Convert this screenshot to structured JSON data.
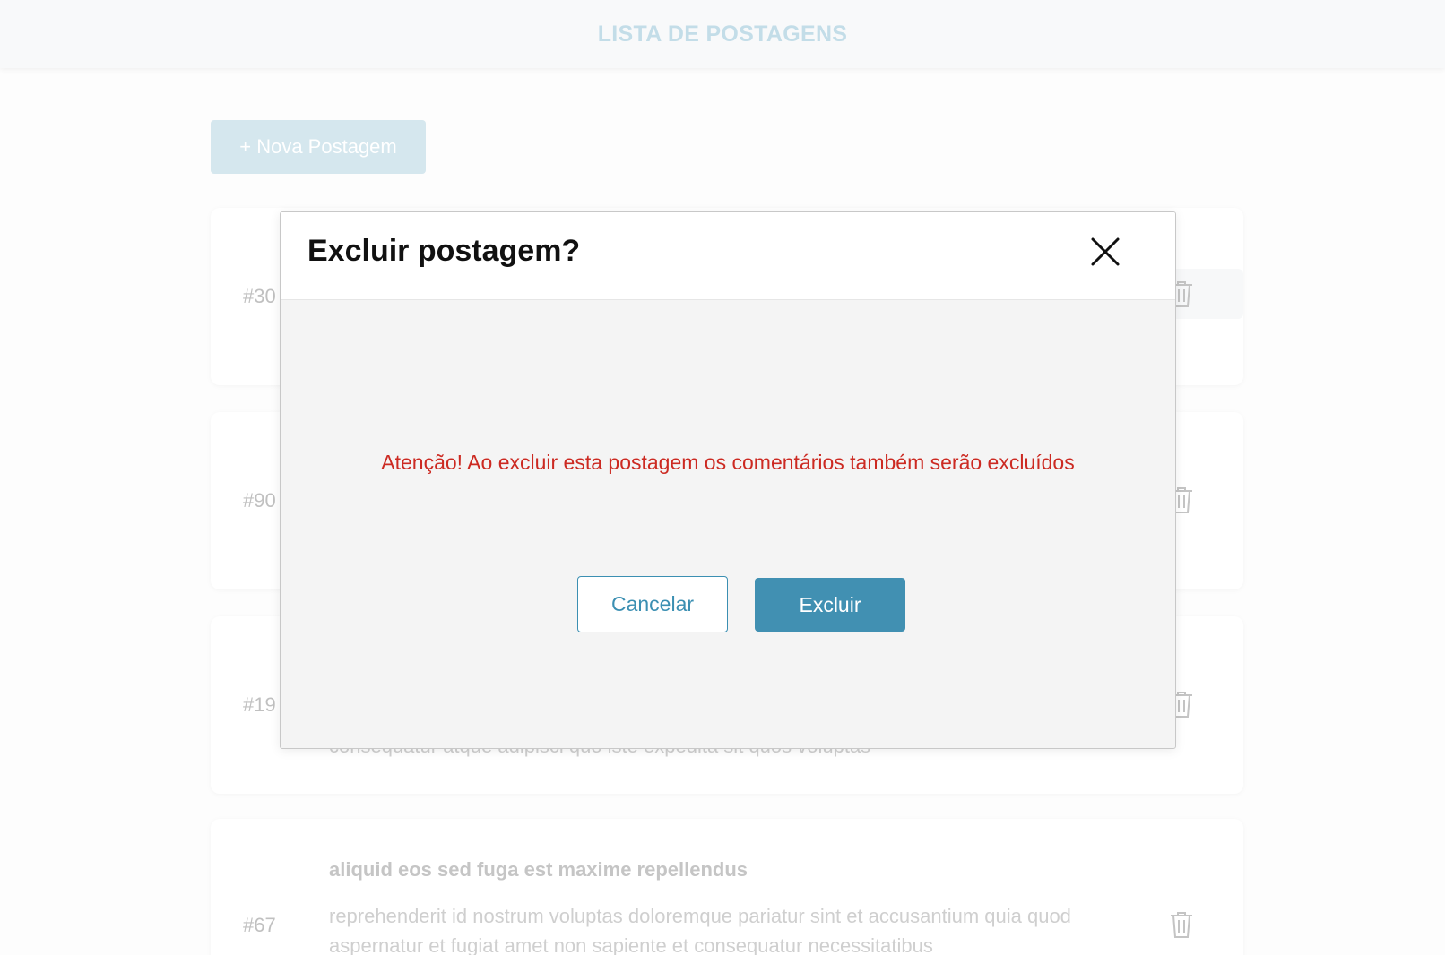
{
  "header": {
    "title": "LISTA DE POSTAGENS"
  },
  "actions": {
    "new_post_label": "+ Nova Postagem"
  },
  "posts": [
    {
      "id": "#30",
      "title": "",
      "body": ""
    },
    {
      "id": "#90",
      "title": "",
      "body": ""
    },
    {
      "id": "#19",
      "title": "",
      "body": "consequatur atque adipisci quo iste expedita sit quos voluptas"
    },
    {
      "id": "#67",
      "title": "aliquid eos sed fuga est maxime repellendus",
      "body": "reprehenderit id nostrum voluptas doloremque pariatur sint et accusantium quia quod aspernatur et fugiat amet non sapiente et consequatur necessitatibus"
    }
  ],
  "modal": {
    "title": "Excluir postagem?",
    "warning": "Atenção! Ao excluir esta postagem os comentários também serão excluídos",
    "cancel_label": "Cancelar",
    "delete_label": "Excluir"
  },
  "colors": {
    "accent": "#4190b2",
    "warning": "#cc2a22",
    "header_title": "#c3dde8"
  },
  "icons": {
    "close": "close-icon",
    "delete": "trash-icon"
  }
}
